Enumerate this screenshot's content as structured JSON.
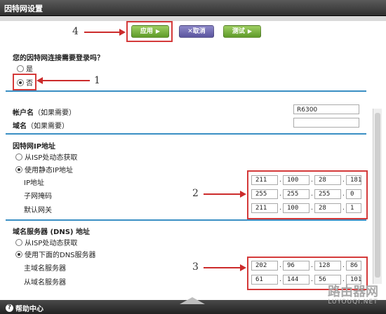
{
  "window": {
    "title": "因特网设置"
  },
  "toolbar": {
    "apply_label": "应用",
    "cancel_label": "取消",
    "test_label": "测试"
  },
  "login_question": {
    "question": "您的因特网连接需要登录吗？",
    "options": [
      {
        "label": "是",
        "selected": false
      },
      {
        "label": "否",
        "selected": true
      }
    ]
  },
  "account": {
    "account_label": "帐户名",
    "account_hint": "（如果需要）",
    "account_value": "R6300",
    "domain_label": "域名",
    "domain_hint": "（如果需要）",
    "domain_value": ""
  },
  "internet_ip": {
    "section_title": "因特网IP地址",
    "options": [
      {
        "label": "从ISP处动态获取",
        "selected": false
      },
      {
        "label": "使用静态IP地址",
        "selected": true
      }
    ],
    "fields": [
      {
        "label": "IP地址",
        "octets": [
          "211",
          "100",
          "28",
          "181"
        ]
      },
      {
        "label": "子网掩码",
        "octets": [
          "255",
          "255",
          "255",
          "0"
        ]
      },
      {
        "label": "默认网关",
        "octets": [
          "211",
          "100",
          "28",
          "1"
        ]
      }
    ]
  },
  "dns": {
    "section_title": "域名服务器 (DNS) 地址",
    "options": [
      {
        "label": "从ISP处动态获取",
        "selected": false
      },
      {
        "label": "使用下面的DNS服务器",
        "selected": true
      }
    ],
    "fields": [
      {
        "label": "主域名服务器",
        "octets": [
          "202",
          "96",
          "128",
          "86"
        ]
      },
      {
        "label": "从域名服务器",
        "octets": [
          "61",
          "144",
          "56",
          "101"
        ]
      }
    ]
  },
  "callouts": {
    "one": "1",
    "two": "2",
    "three": "3",
    "four": "4"
  },
  "footer": {
    "help_label": "帮助中心",
    "help_icon_glyph": "?"
  },
  "watermark": {
    "line1": "路由器网",
    "line2": "LUYOUQI.NET"
  },
  "colors": {
    "accent_blue": "#3a8fc4",
    "callout_red": "#d43a3a",
    "apply_green": "#5e9a28",
    "cancel_purple": "#5a549e"
  }
}
